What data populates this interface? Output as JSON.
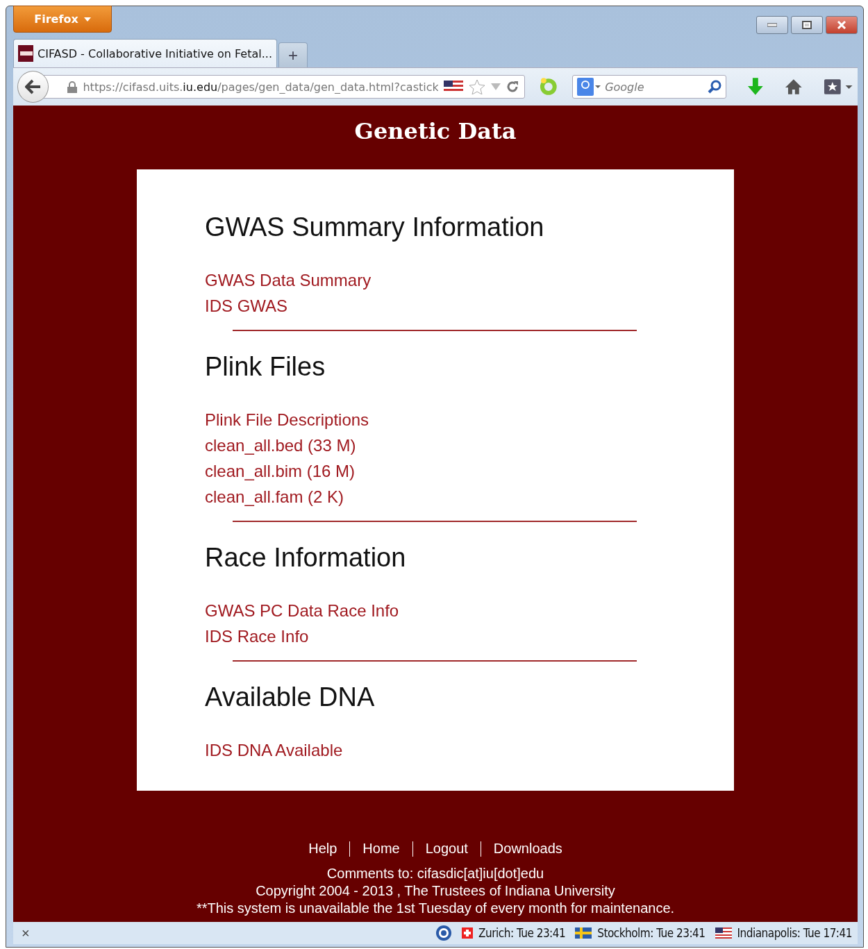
{
  "browser": {
    "menu_button": "Firefox",
    "tabs": [
      {
        "label": "CIFASD - Collaborative Initiative on Fetal...",
        "selected": true
      }
    ],
    "new_tab": "+",
    "url": "https://cifasd.uits.**iu.edu**/pages/gen_data/gen_data.html?castick",
    "search": {
      "placeholder": "Google"
    }
  },
  "page": {
    "title": "Genetic Data",
    "sections": [
      {
        "heading": "GWAS Summary Information",
        "links": [
          "GWAS Data Summary",
          "IDS GWAS"
        ]
      },
      {
        "heading": "Plink Files",
        "links": [
          "Plink File Descriptions",
          "clean_all.bed (33 M)",
          "clean_all.bim (16 M)",
          "clean_all.fam (2 K)"
        ]
      },
      {
        "heading": "Race Information",
        "links": [
          "GWAS PC Data Race Info",
          "IDS Race Info"
        ]
      },
      {
        "heading": "Available DNA",
        "links": [
          "IDS DNA Available"
        ]
      }
    ]
  },
  "footer": {
    "nav": [
      "Help",
      "Home",
      "Logout",
      "Downloads"
    ],
    "lines": [
      "Comments to: cifasdic[at]iu[dot]edu",
      "Copyright 2004 - 2013 , The Trustees of Indiana University",
      "**This system is unavailable the 1st Tuesday of every month for maintenance."
    ]
  },
  "status_bar": {
    "close": "×",
    "clocks": [
      {
        "label": "Zurich: Tue 23:41",
        "kind": "swiss"
      },
      {
        "label": "Stockholm: Tue 23:41",
        "kind": "sweden"
      },
      {
        "label": "Indianapolis: Tue 17:41",
        "kind": "us"
      }
    ]
  }
}
